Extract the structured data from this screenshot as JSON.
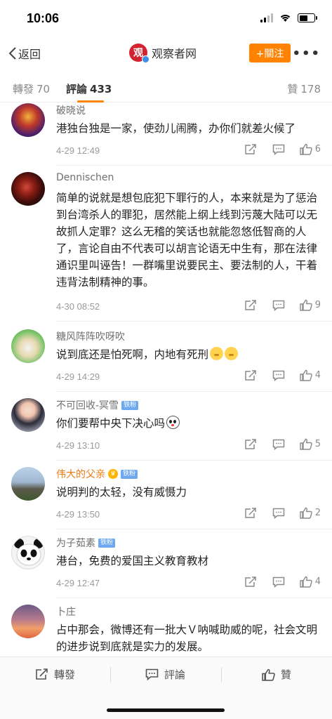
{
  "status": {
    "time": "10:06"
  },
  "nav": {
    "back_label": "返回",
    "logo_char": "观",
    "title": "观察者网",
    "follow_label": "+關注",
    "more_label": "•••"
  },
  "tabs": {
    "repost": {
      "label": "轉發",
      "count": "70"
    },
    "comment": {
      "label": "評論",
      "count": "433"
    },
    "like": {
      "label": "贊",
      "count": "178"
    }
  },
  "comments": [
    {
      "user": "破晓说",
      "text": "港独台独是一家，使劲儿闹腾，办你们就差火候了",
      "time": "4-29 12:49",
      "likes": "6"
    },
    {
      "user": "Dennischen",
      "text": "简单的说就是想包庇犯下罪行的人，本来就是为了惩治到台湾杀人的罪犯，居然能上纲上线到污蔑大陆可以无故抓人定罪？这么无稽的笑话也就能忽悠低智商的人了，言论自由不代表可以胡言论语无中生有，那在法律通识里叫诬告！一群嘴里说要民主、要法制的人，干着违背法制精神的事。",
      "time": "4-30 08:52",
      "likes": "9"
    },
    {
      "user": "糖风阵阵吹呀吹",
      "text": "说到底还是怕死啊，内地有死刑",
      "time": "4-29 14:29",
      "likes": "4"
    },
    {
      "user": "不可回收-冥雪",
      "badge": "铁粉",
      "text": "你们要帮中央下决心吗",
      "time": "4-29 13:10",
      "likes": "5"
    },
    {
      "user": "伟大的父亲",
      "badge": "铁粉",
      "text": "说明判的太轻，没有威慑力",
      "time": "4-29 13:50",
      "likes": "2"
    },
    {
      "user": "为子茹素",
      "badge": "铁粉",
      "text": "港台，免费的爱国主义教育教材",
      "time": "4-29 12:47",
      "likes": "4"
    },
    {
      "user": "卜庄",
      "text": "占中那会，微博还有一批大Ｖ呐喊助威的呢，社会文明的进步说到底就是实力的发展。"
    }
  ],
  "bottom_bar": {
    "repost": "轉發",
    "comment": "評論",
    "like": "贊"
  },
  "colors": {
    "accent": "#ff8200",
    "vip_name": "#f07b12",
    "badge": "#6ea8ee"
  }
}
